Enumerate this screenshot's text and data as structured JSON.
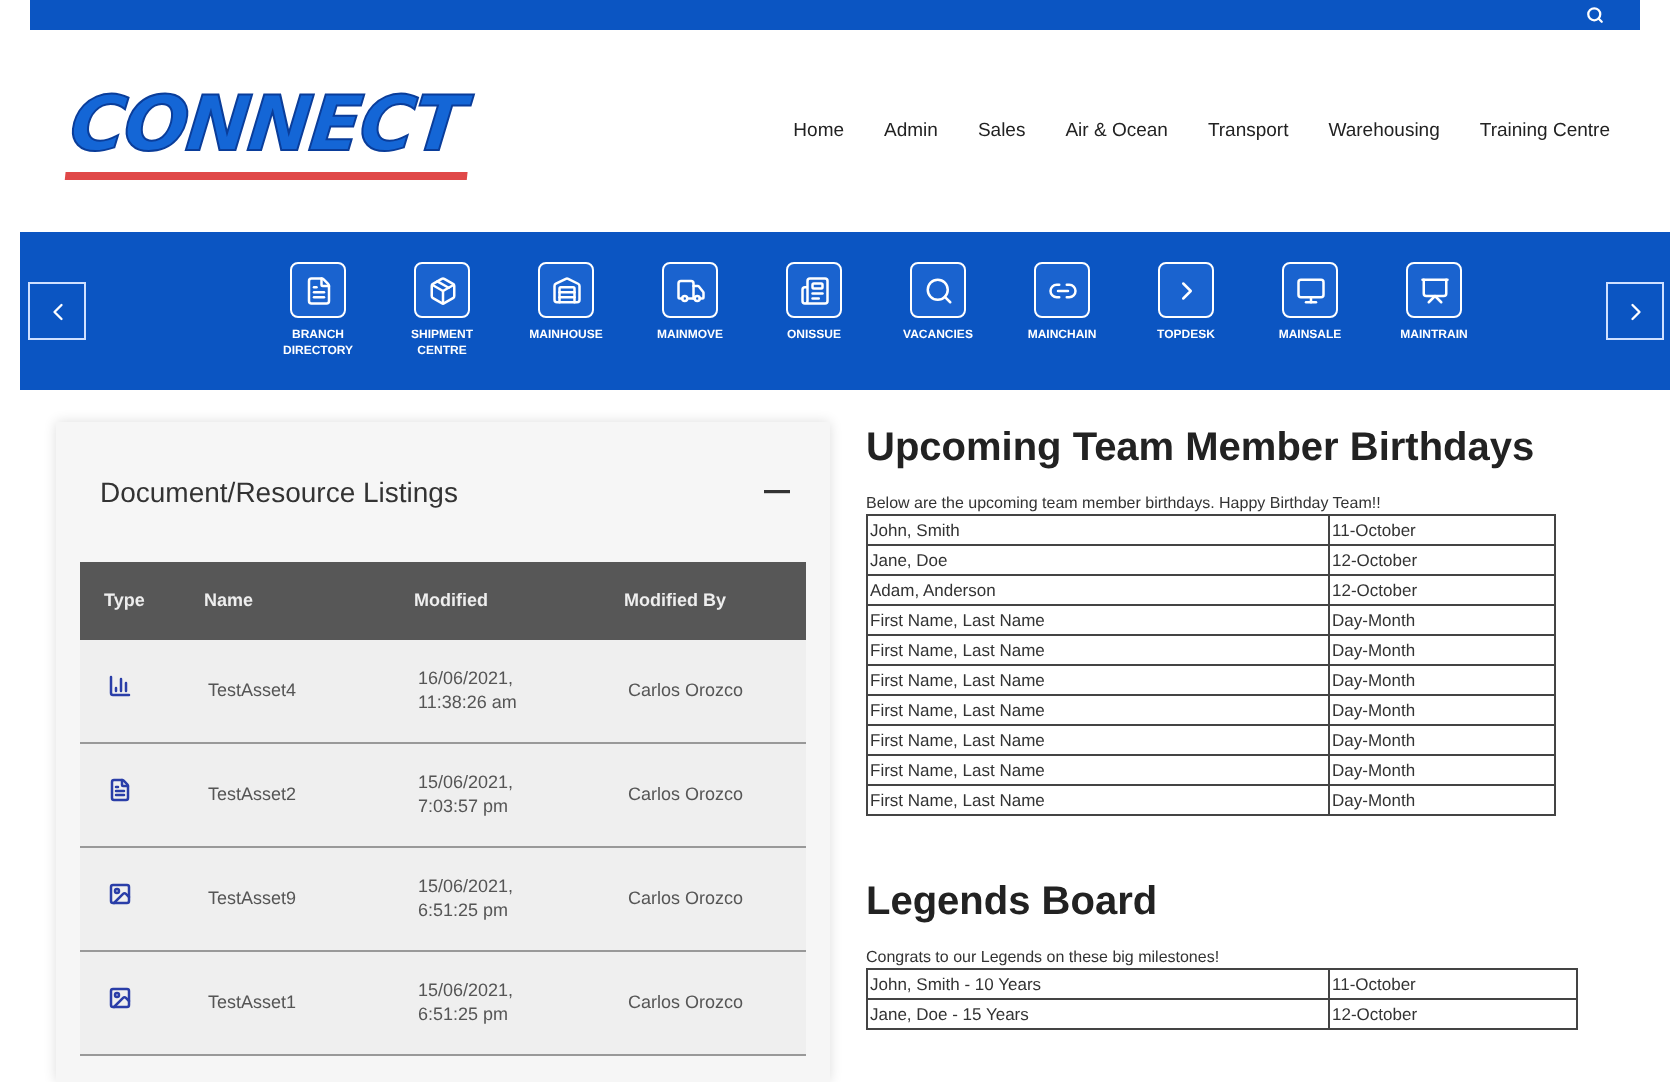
{
  "header": {
    "logo": "CONNECT",
    "nav": [
      "Home",
      "Admin",
      "Sales",
      "Air & Ocean",
      "Transport",
      "Warehousing",
      "Training Centre"
    ]
  },
  "shortcuts": [
    {
      "label": "BRANCH DIRECTORY",
      "kind": "directory"
    },
    {
      "label": "SHIPMENT CENTRE",
      "kind": "shipment"
    },
    {
      "label": "MAINHOUSE",
      "kind": "warehouse"
    },
    {
      "label": "MAINMOVE",
      "kind": "truck"
    },
    {
      "label": "ONISSUE",
      "kind": "news"
    },
    {
      "label": "VACANCIES",
      "kind": "search"
    },
    {
      "label": "MAINCHAIN",
      "kind": "link"
    },
    {
      "label": "TOPDESK",
      "kind": "chevron"
    },
    {
      "label": "MAINSALE",
      "kind": "monitor"
    },
    {
      "label": "MAINTRAIN",
      "kind": "presentation"
    }
  ],
  "documents": {
    "title": "Document/Resource Listings",
    "columns": [
      "Type",
      "Name",
      "Modified",
      "Modified By"
    ],
    "rows": [
      {
        "kind": "chart",
        "name": "TestAsset4",
        "modified": "16/06/2021, 11:38:26 am",
        "modified_by": "Carlos Orozco"
      },
      {
        "kind": "document",
        "name": "TestAsset2",
        "modified": "15/06/2021, 7:03:57 pm",
        "modified_by": "Carlos Orozco"
      },
      {
        "kind": "image",
        "name": "TestAsset9",
        "modified": "15/06/2021, 6:51:25 pm",
        "modified_by": "Carlos Orozco"
      },
      {
        "kind": "image",
        "name": "TestAsset1",
        "modified": "15/06/2021, 6:51:25 pm",
        "modified_by": "Carlos Orozco"
      }
    ]
  },
  "birthdays": {
    "title": "Upcoming Team Member Birthdays",
    "intro": "Below are the upcoming team member birthdays. Happy Birthday Team!!",
    "rows": [
      [
        "John, Smith",
        "11-October"
      ],
      [
        "Jane, Doe",
        "12-October"
      ],
      [
        "Adam, Anderson",
        "12-October"
      ],
      [
        "First Name, Last Name",
        "Day-Month"
      ],
      [
        "First Name, Last Name",
        "Day-Month"
      ],
      [
        "First Name, Last Name",
        "Day-Month"
      ],
      [
        "First Name, Last Name",
        "Day-Month"
      ],
      [
        "First Name, Last Name",
        "Day-Month"
      ],
      [
        "First Name, Last Name",
        "Day-Month"
      ],
      [
        "First Name, Last Name",
        "Day-Month"
      ]
    ]
  },
  "legends": {
    "title": "Legends Board",
    "intro": "Congrats to our Legends on these big milestones!",
    "rows": [
      [
        "John, Smith - 10 Years",
        "11-October"
      ],
      [
        "Jane, Doe - 15 Years",
        "12-October"
      ]
    ]
  }
}
